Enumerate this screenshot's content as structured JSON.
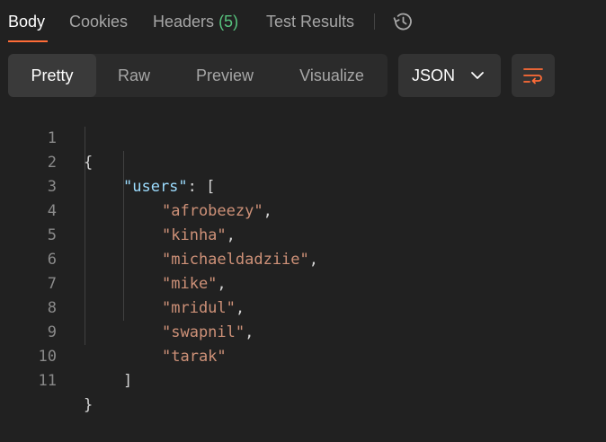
{
  "tabs": [
    {
      "label": "Body",
      "active": true
    },
    {
      "label": "Cookies",
      "active": false
    },
    {
      "label": "Headers",
      "count": "(5)",
      "active": false
    },
    {
      "label": "Test Results",
      "active": false
    }
  ],
  "history_icon": "history-icon",
  "view_modes": [
    {
      "label": "Pretty",
      "active": true
    },
    {
      "label": "Raw",
      "active": false
    },
    {
      "label": "Preview",
      "active": false
    },
    {
      "label": "Visualize",
      "active": false
    }
  ],
  "format_select": {
    "value": "JSON",
    "icon": "chevron-down-icon"
  },
  "wrap_button": {
    "icon": "text-wrap-icon"
  },
  "colors": {
    "accent": "#ff6c37",
    "count": "#57c27d",
    "json_key": "#9cdcfe",
    "json_string": "#ce9178"
  },
  "editor": {
    "line_numbers": [
      "1",
      "2",
      "3",
      "4",
      "5",
      "6",
      "7",
      "8",
      "9",
      "10",
      "11"
    ],
    "open_brace": "{",
    "key": "\"users\"",
    "key_sep": ": [",
    "items": [
      "\"afrobeezy\"",
      "\"kinha\"",
      "\"michaeldadziie\"",
      "\"mike\"",
      "\"mridul\"",
      "\"swapnil\"",
      "\"tarak\""
    ],
    "comma": ",",
    "close_bracket": "]",
    "close_brace": "}"
  }
}
